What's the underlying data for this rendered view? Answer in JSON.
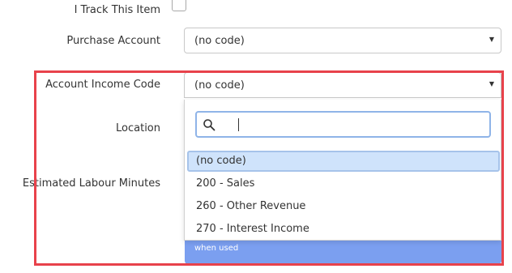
{
  "form": {
    "track_item_label": "I Track This Item",
    "purchase_account_label": "Purchase Account",
    "purchase_account_value": "(no code)",
    "income_code_label": "Account Income Code",
    "income_code_value": "(no code)",
    "location_label": "Location",
    "labour_minutes_label": "Estimated Labour Minutes",
    "hint_text": "when used"
  },
  "dropdown": {
    "search_value": "",
    "options": [
      {
        "label": "(no code)",
        "selected": true
      },
      {
        "label": "200 - Sales",
        "selected": false
      },
      {
        "label": "260 - Other Revenue",
        "selected": false
      },
      {
        "label": "270 - Interest Income",
        "selected": false
      }
    ]
  },
  "icons": {
    "search": "search-icon",
    "dropdown_arrow": "caret-down-icon",
    "checkbox": "checkbox-icon"
  },
  "colors": {
    "highlight_border": "#e8424b",
    "selected_option_bg": "#cfe3fb",
    "search_focus_border": "#8fb4e8",
    "hint_bar_bg": "#7b9ff0"
  }
}
